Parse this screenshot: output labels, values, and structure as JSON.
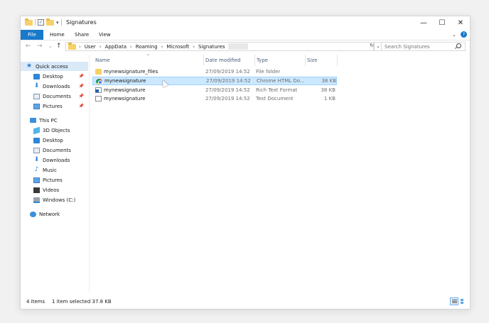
{
  "window": {
    "title": "Signatures",
    "controls": {
      "minimize": "—",
      "maximize": "☐",
      "close": "✕"
    }
  },
  "ribbon": {
    "tabs": [
      "File",
      "Home",
      "Share",
      "View"
    ],
    "expand_icon": "chevron-down-icon",
    "help_icon": "help-icon",
    "accent_color": "#1979ca"
  },
  "address_bar": {
    "back": "←",
    "forward": "→",
    "recent": "⌄",
    "up": "↑",
    "path": [
      "User",
      "AppData",
      "Roaming",
      "Microsoft",
      "Signatures"
    ],
    "separator": "›",
    "dropdown": "⌄",
    "refresh": "↻"
  },
  "search": {
    "placeholder": "Search Signatures"
  },
  "nav_pane": {
    "quick_access": "Quick access",
    "quick_items": [
      "Desktop",
      "Downloads",
      "Documents",
      "Pictures"
    ],
    "this_pc": "This PC",
    "pc_items": [
      "3D Objects",
      "Desktop",
      "Documents",
      "Downloads",
      "Music",
      "Pictures",
      "Videos",
      "Windows (C:)"
    ],
    "network": "Network",
    "pin_glyph": "📌"
  },
  "columns": [
    "Name",
    "Date modified",
    "Type",
    "Size"
  ],
  "sort_indicator": "^",
  "files": [
    {
      "name": "mynewsignature_files",
      "date": "27/09/2019 14:52",
      "type": "File folder",
      "size": "",
      "icon": "folder-icon"
    },
    {
      "name": "mynewsignature",
      "date": "27/09/2019 14:52",
      "type": "Chrome HTML Do...",
      "size": "38 KB",
      "icon": "chrome-html-icon"
    },
    {
      "name": "mynewsignature",
      "date": "27/09/2019 14:52",
      "type": "Rich Text Format",
      "size": "38 KB",
      "icon": "rich-text-icon"
    },
    {
      "name": "mynewsignature",
      "date": "27/09/2019 14:52",
      "type": "Text Document",
      "size": "1 KB",
      "icon": "text-document-icon"
    }
  ],
  "selected_row": 1,
  "status": {
    "item_count": "4 items",
    "selection": "1 item selected  37.8 KB"
  }
}
